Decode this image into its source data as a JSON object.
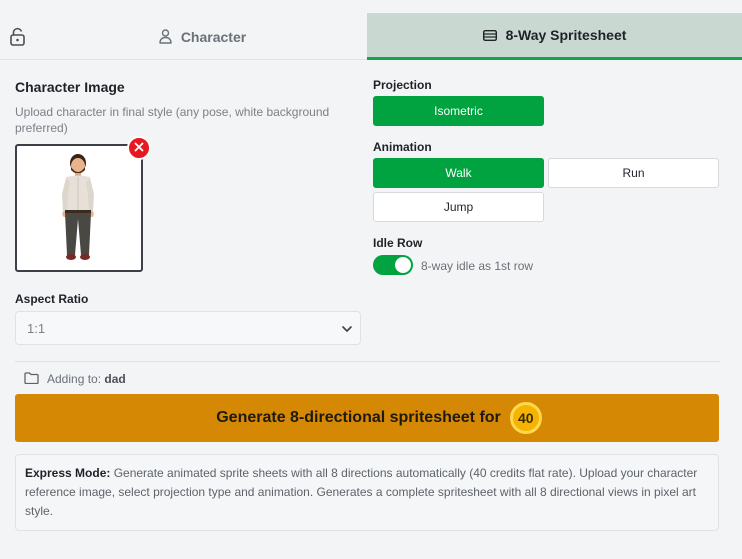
{
  "tabs": {
    "character_label": "Character",
    "sprite_label": "8-Way Spritesheet"
  },
  "left": {
    "section_title": "Character Image",
    "hint": "Upload character in final style (any pose, white background preferred)",
    "aspect_label": "Aspect Ratio",
    "aspect_value": "1:1"
  },
  "right": {
    "projection_label": "Projection",
    "projection_option": "Isometric",
    "animation_label": "Animation",
    "animation_options": [
      "Walk",
      "Run",
      "Jump"
    ],
    "idle_label": "Idle Row",
    "idle_toggle_text": "8-way idle as 1st row",
    "idle_enabled": true
  },
  "footer": {
    "adding_prefix": "Adding to:",
    "adding_target": "dad",
    "generate_label": "Generate 8-directional spritesheet for",
    "credits": "40",
    "info_title": "Express Mode:",
    "info_text": " Generate animated sprite sheets with all 8 directions automatically (40 credits flat rate). Upload your character reference image, select projection type and animation. Generates a complete spritesheet with all 8 directional views in pixel art style."
  },
  "colors": {
    "accent_green": "#01a240",
    "generate_orange": "#d48804",
    "remove_red": "#e5191f",
    "active_tab_bg": "#c9d8d0"
  },
  "icons": {
    "lock": "lock-open-icon",
    "character_tab": "user-icon",
    "sprite_tab": "spritesheet-icon",
    "remove": "close-icon",
    "folder": "folder-icon",
    "select": "chevron-down-icon"
  }
}
